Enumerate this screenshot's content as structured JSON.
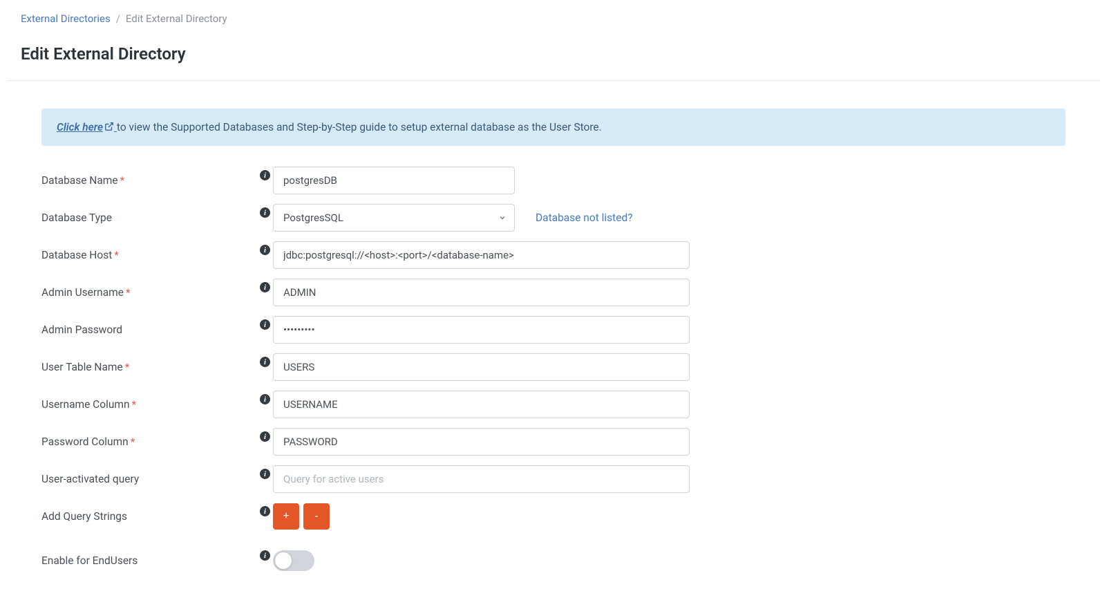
{
  "breadcrumb": {
    "parent": "External Directories",
    "current": "Edit External Directory"
  },
  "page_title": "Edit External Directory",
  "banner": {
    "link_text": "Click here",
    "text": " to view the Supported Databases and Step-by-Step guide to setup external database as the User Store."
  },
  "form": {
    "database_name": {
      "label": "Database Name",
      "required": true,
      "value": "postgresDB"
    },
    "database_type": {
      "label": "Database Type",
      "required": false,
      "value": "PostgresSQL",
      "side_link": "Database not listed?"
    },
    "database_host": {
      "label": "Database Host",
      "required": true,
      "value": "jdbc:postgresql://<host>:<port>/<database-name>"
    },
    "admin_username": {
      "label": "Admin Username",
      "required": true,
      "value": "ADMIN"
    },
    "admin_password": {
      "label": "Admin Password",
      "required": false,
      "value": "•••••••••"
    },
    "user_table": {
      "label": "User Table Name",
      "required": true,
      "value": "USERS"
    },
    "username_column": {
      "label": "Username Column",
      "required": true,
      "value": "USERNAME"
    },
    "password_column": {
      "label": "Password Column",
      "required": true,
      "value": "PASSWORD"
    },
    "user_activated_query": {
      "label": "User-activated query",
      "required": false,
      "value": "",
      "placeholder": "Query for active users"
    },
    "add_query_strings": {
      "label": "Add Query Strings",
      "plus": "+",
      "minus": "-"
    },
    "enable_endusers": {
      "label": "Enable for EndUsers",
      "value": false
    }
  }
}
